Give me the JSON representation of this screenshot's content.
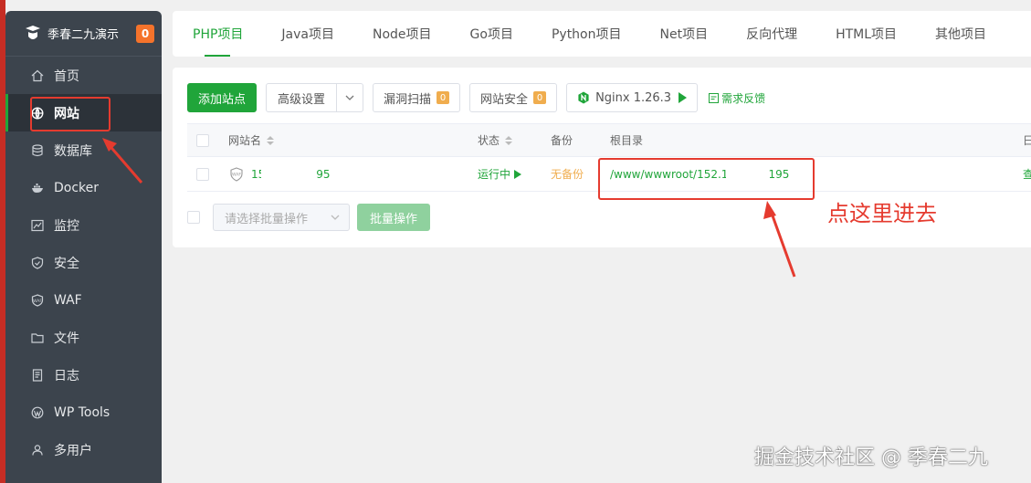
{
  "sidebar": {
    "title": "季春二九演示",
    "badge": "0",
    "items": [
      {
        "label": "首页",
        "icon": "home-icon"
      },
      {
        "label": "网站",
        "icon": "globe-icon"
      },
      {
        "label": "数据库",
        "icon": "database-icon"
      },
      {
        "label": "Docker",
        "icon": "docker-icon"
      },
      {
        "label": "监控",
        "icon": "monitor-icon"
      },
      {
        "label": "安全",
        "icon": "shield-icon"
      },
      {
        "label": "WAF",
        "icon": "waf-shield-icon"
      },
      {
        "label": "文件",
        "icon": "folder-icon"
      },
      {
        "label": "日志",
        "icon": "log-icon"
      },
      {
        "label": "WP Tools",
        "icon": "wordpress-icon"
      },
      {
        "label": "多用户",
        "icon": "users-icon"
      }
    ],
    "active_index": 1
  },
  "tabs": [
    "PHP项目",
    "Java项目",
    "Node项目",
    "Go项目",
    "Python项目",
    "Net项目",
    "反向代理",
    "HTML项目",
    "其他项目"
  ],
  "toolbar": {
    "add_site": "添加站点",
    "advanced": "高级设置",
    "vuln_scan": "漏洞扫描",
    "vuln_count": "0",
    "site_security": "网站安全",
    "security_count": "0",
    "nginx": "Nginx 1.26.3",
    "feedback": "需求反馈"
  },
  "table": {
    "headers": {
      "name": "网站名",
      "status": "状态",
      "backup": "备份",
      "root": "根目录",
      "extra": "日"
    },
    "rows": [
      {
        "name_prefix": "15",
        "name_suffix": "95",
        "status": "运行中",
        "backup": "无备份",
        "root_prefix": "/www/wwwroot/152.1",
        "root_suffix": "195",
        "action": "查"
      }
    ]
  },
  "batch": {
    "placeholder": "请选择批量操作",
    "button": "批量操作"
  },
  "annotation": "点这里进去",
  "watermark": "掘金技术社区 @ 季春二九",
  "colors": {
    "accent": "#20a53a",
    "sidebar": "#3c444d",
    "annotation": "#e53b2f",
    "badge": "#f5732b"
  }
}
